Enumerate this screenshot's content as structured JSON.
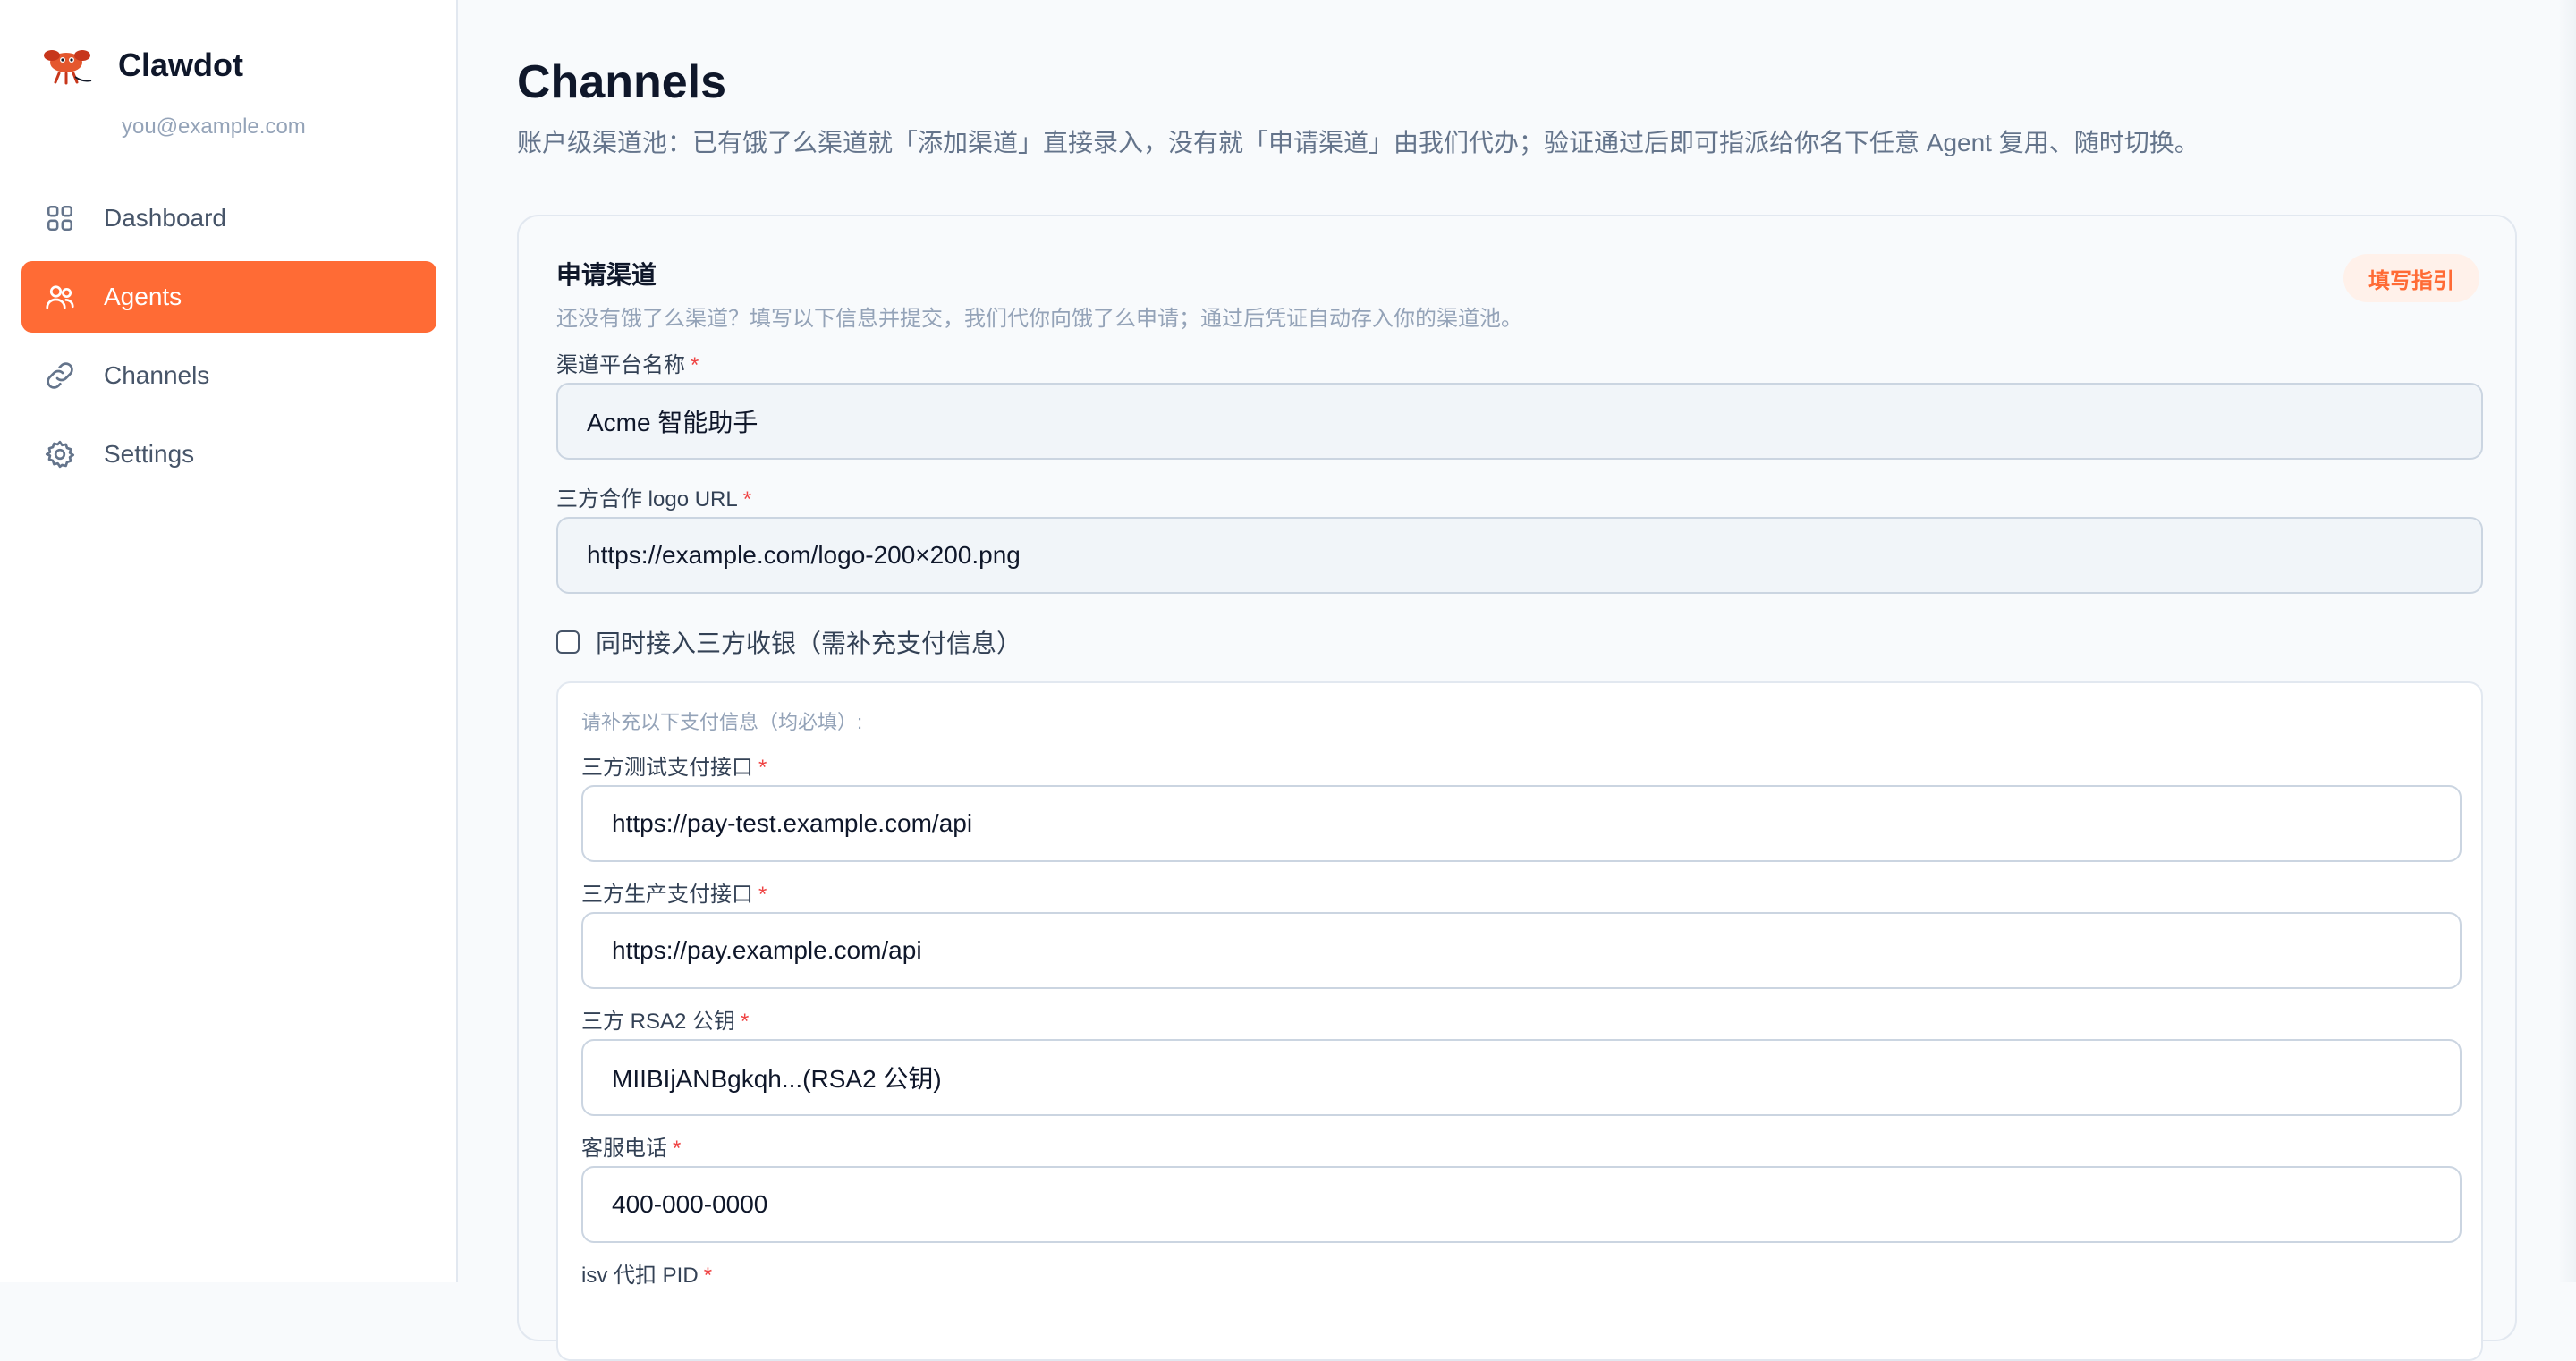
{
  "app": {
    "name": "Clawdot",
    "email": "you@example.com",
    "accent": "#ff6b35"
  },
  "nav": {
    "items": [
      {
        "label": "Dashboard",
        "icon": "grid-icon",
        "active": false
      },
      {
        "label": "Agents",
        "icon": "users-icon",
        "active": true
      },
      {
        "label": "Channels",
        "icon": "link-icon",
        "active": false
      },
      {
        "label": "Settings",
        "icon": "gear-icon",
        "active": false
      }
    ]
  },
  "page": {
    "title": "Channels",
    "subtitle": "账户级渠道池：已有饿了么渠道就「添加渠道」直接录入，没有就「申请渠道」由我们代办；验证通过后即可指派给你名下任意 Agent 复用、随时切换。"
  },
  "form": {
    "title": "申请渠道",
    "description": "还没有饿了么渠道？填写以下信息并提交，我们代你向饿了么申请；通过后凭证自动存入你的渠道池。",
    "guide_label": "填写指引",
    "platform_name": {
      "label": "渠道平台名称",
      "required": "*",
      "value": "Acme 智能助手"
    },
    "logo_url": {
      "label": "三方合作 logo URL",
      "required": "*",
      "value": "https://example.com/logo-200×200.png"
    },
    "payment_checkbox": {
      "label": "同时接入三方收银（需补充支付信息）",
      "checked": false
    },
    "payment": {
      "hint": "请补充以下支付信息（均必填）:",
      "test_api": {
        "label": "三方测试支付接口",
        "required": "*",
        "value": "https://pay-test.example.com/api"
      },
      "prod_api": {
        "label": "三方生产支付接口",
        "required": "*",
        "value": "https://pay.example.com/api"
      },
      "rsa_key": {
        "label": "三方 RSA2 公钥",
        "required": "*",
        "value": "MIIBIjANBgkqh...(RSA2 公钥)"
      },
      "phone": {
        "label": "客服电话",
        "required": "*",
        "value": "400-000-0000"
      },
      "isv_pid": {
        "label": "isv 代扣 PID",
        "required": "*"
      }
    }
  }
}
